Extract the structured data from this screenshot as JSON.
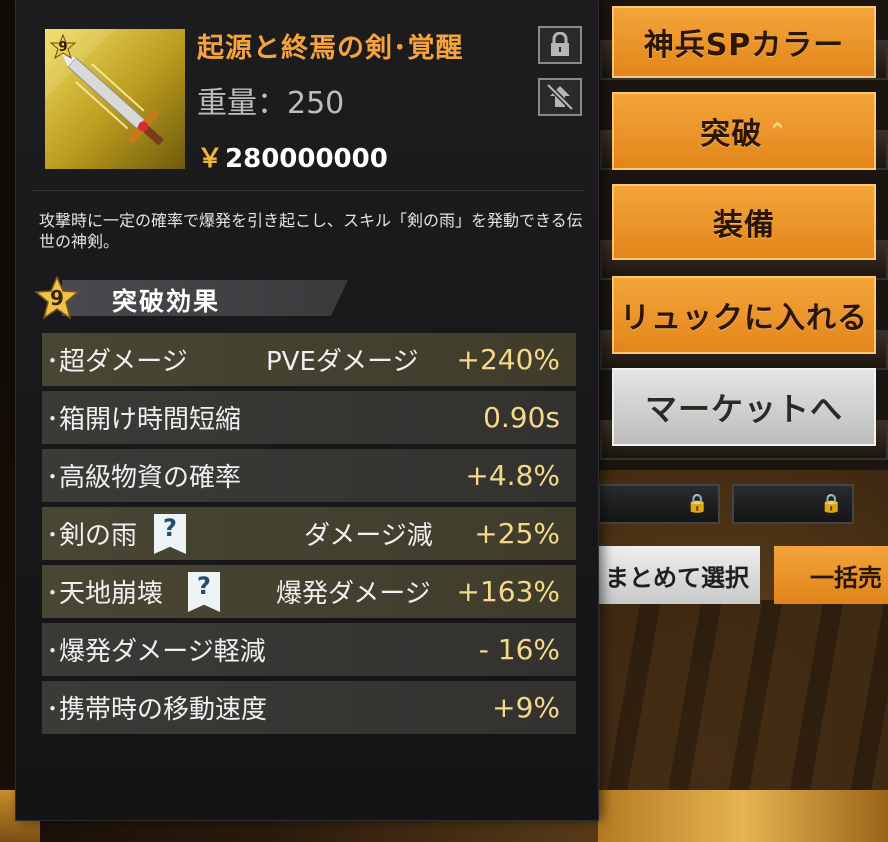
{
  "item": {
    "level": "9",
    "name": "起源と終焉の剣･覚醒",
    "weight": "重量：250",
    "price_symbol": "￥",
    "price": "280000000",
    "description": "攻撃時に一定の確率で爆発を引き起こし、スキル「剣の雨」を発動できる伝世の神剣。"
  },
  "icons": {
    "lock": "lock-icon",
    "no_market": "no-trade-icon"
  },
  "breakthrough": {
    "level": "9",
    "title": "突破効果",
    "effects": [
      {
        "name": "･超ダメージ",
        "detail": "PVEダメージ",
        "value": "+240%"
      },
      {
        "name": "･箱開け時間短縮",
        "detail": "",
        "value": "0.90s"
      },
      {
        "name": "･高級物資の確率",
        "detail": "",
        "value": "+4.8%"
      },
      {
        "name": "･剣の雨",
        "detail": "ダメージ減",
        "value": "+25%",
        "help": "?"
      },
      {
        "name": "･天地崩壊",
        "detail": "爆発ダメージ",
        "value": "+163%",
        "help": "?"
      },
      {
        "name": "･爆発ダメージ軽減",
        "detail": "",
        "value": "- 16%"
      },
      {
        "name": "･携帯時の移動速度",
        "detail": "",
        "value": "+9%"
      }
    ]
  },
  "actions": {
    "sp_color": "神兵SPカラー",
    "breakthrough": "突破",
    "breakthrough_mark": "⌃",
    "equip": "装備",
    "to_backpack": "リュックに入れる",
    "to_market": "マーケットへ",
    "batch_select": "まとめて選択",
    "bulk_sell": "一括売"
  },
  "colors": {
    "accent_orange": "#f5a33d",
    "value_gold": "#f4d98a",
    "button_orange": "#e3861b"
  }
}
